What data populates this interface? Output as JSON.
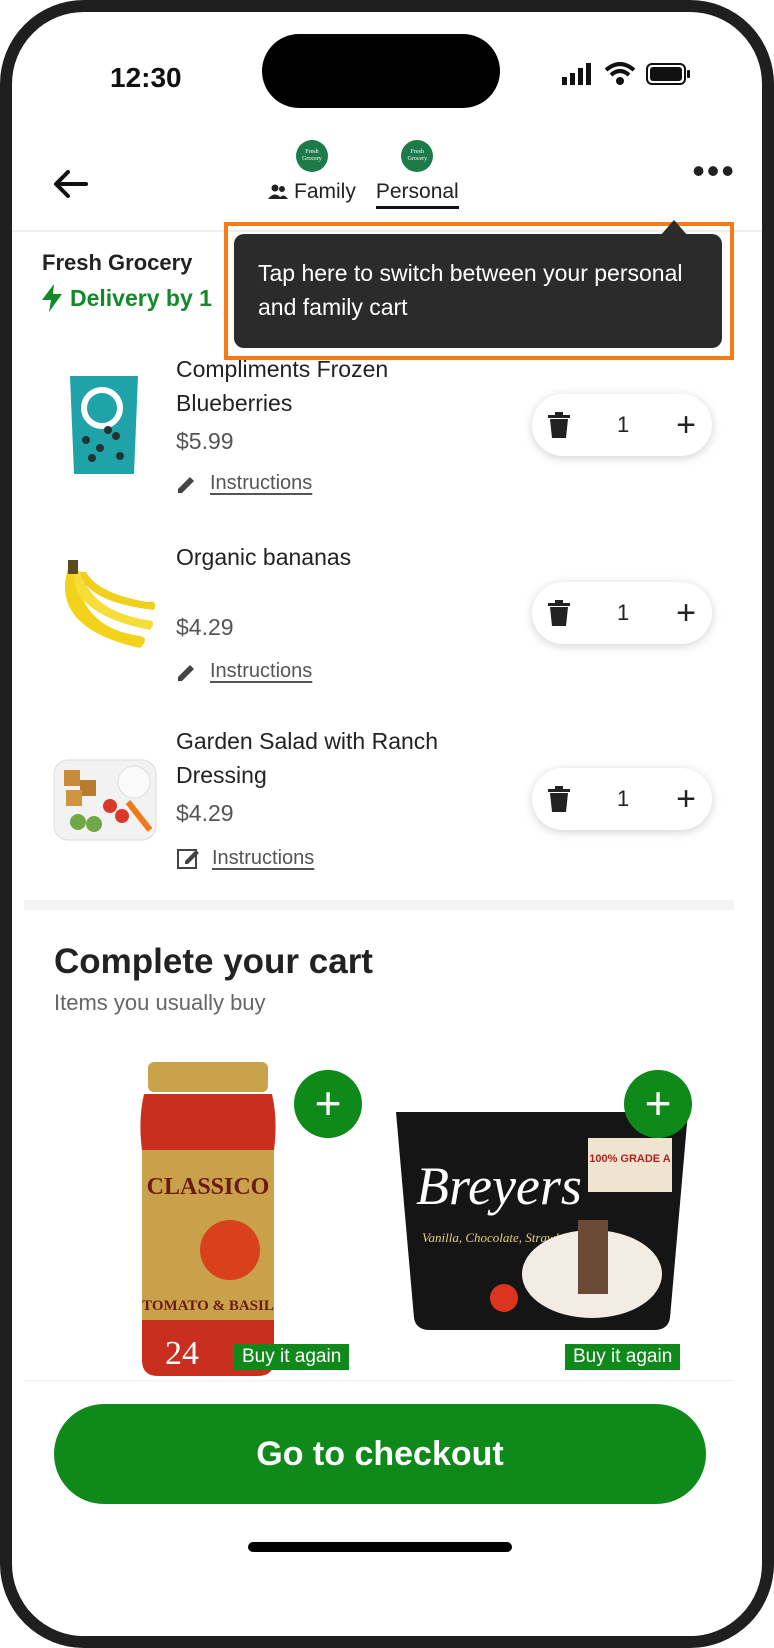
{
  "status": {
    "time": "12:30"
  },
  "header": {
    "tabs": [
      {
        "label": "Family",
        "logo_text": "Fresh Grocery"
      },
      {
        "label": "Personal",
        "logo_text": "Fresh Grocery",
        "active": true
      }
    ]
  },
  "store": {
    "name": "Fresh Grocery",
    "delivery": "Delivery by 1"
  },
  "tooltip": {
    "text": "Tap here to switch between your personal and family cart"
  },
  "cart_items": [
    {
      "name": "Compliments Frozen Blueberries",
      "price": "$5.99",
      "instructions": "Instructions",
      "quantity": "1"
    },
    {
      "name": "Organic bananas",
      "price": "$4.29",
      "instructions": "Instructions",
      "quantity": "1"
    },
    {
      "name": "Garden Salad with Ranch Dressing",
      "price": "$4.29",
      "instructions": "Instructions",
      "quantity": "1"
    }
  ],
  "complete_cart": {
    "title": "Complete your cart",
    "subtitle": "Items you usually buy",
    "products": [
      {
        "badge": "Buy it again",
        "jar_brand": "CLASSICO",
        "jar_flavor": "TOMATO & BASIL",
        "jar_size": "24"
      },
      {
        "badge": "Buy it again",
        "tub_brand": "Breyers",
        "tub_flavor": "Vanilla, Chocolate, Strawberry",
        "tub_grade": "100% GRADE A"
      }
    ]
  },
  "checkout": {
    "label": "Go to checkout"
  },
  "colors": {
    "accent": "#0f8a1a",
    "highlight": "#f47b16",
    "tooltip_bg": "#2b2b2b"
  }
}
